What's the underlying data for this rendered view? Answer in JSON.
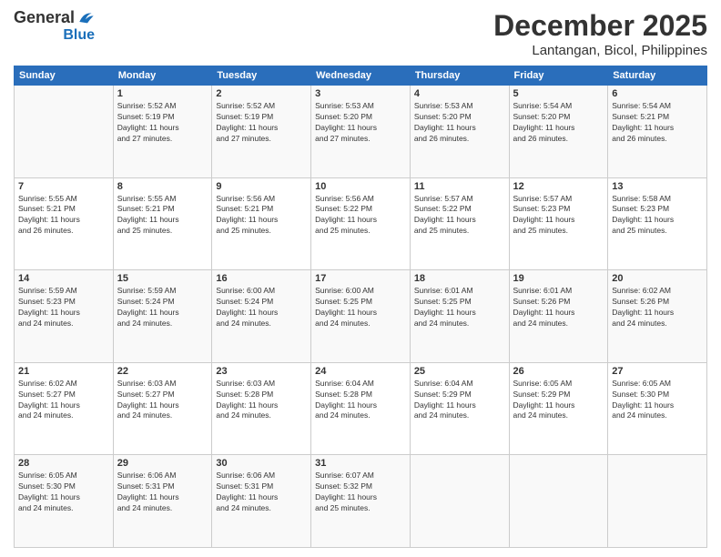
{
  "header": {
    "logo_line1": "General",
    "logo_line2": "Blue",
    "month": "December 2025",
    "location": "Lantangan, Bicol, Philippines"
  },
  "days_of_week": [
    "Sunday",
    "Monday",
    "Tuesday",
    "Wednesday",
    "Thursday",
    "Friday",
    "Saturday"
  ],
  "weeks": [
    [
      {
        "day": "",
        "info": ""
      },
      {
        "day": "1",
        "info": "Sunrise: 5:52 AM\nSunset: 5:19 PM\nDaylight: 11 hours\nand 27 minutes."
      },
      {
        "day": "2",
        "info": "Sunrise: 5:52 AM\nSunset: 5:19 PM\nDaylight: 11 hours\nand 27 minutes."
      },
      {
        "day": "3",
        "info": "Sunrise: 5:53 AM\nSunset: 5:20 PM\nDaylight: 11 hours\nand 27 minutes."
      },
      {
        "day": "4",
        "info": "Sunrise: 5:53 AM\nSunset: 5:20 PM\nDaylight: 11 hours\nand 26 minutes."
      },
      {
        "day": "5",
        "info": "Sunrise: 5:54 AM\nSunset: 5:20 PM\nDaylight: 11 hours\nand 26 minutes."
      },
      {
        "day": "6",
        "info": "Sunrise: 5:54 AM\nSunset: 5:21 PM\nDaylight: 11 hours\nand 26 minutes."
      }
    ],
    [
      {
        "day": "7",
        "info": "Sunrise: 5:55 AM\nSunset: 5:21 PM\nDaylight: 11 hours\nand 26 minutes."
      },
      {
        "day": "8",
        "info": "Sunrise: 5:55 AM\nSunset: 5:21 PM\nDaylight: 11 hours\nand 25 minutes."
      },
      {
        "day": "9",
        "info": "Sunrise: 5:56 AM\nSunset: 5:21 PM\nDaylight: 11 hours\nand 25 minutes."
      },
      {
        "day": "10",
        "info": "Sunrise: 5:56 AM\nSunset: 5:22 PM\nDaylight: 11 hours\nand 25 minutes."
      },
      {
        "day": "11",
        "info": "Sunrise: 5:57 AM\nSunset: 5:22 PM\nDaylight: 11 hours\nand 25 minutes."
      },
      {
        "day": "12",
        "info": "Sunrise: 5:57 AM\nSunset: 5:23 PM\nDaylight: 11 hours\nand 25 minutes."
      },
      {
        "day": "13",
        "info": "Sunrise: 5:58 AM\nSunset: 5:23 PM\nDaylight: 11 hours\nand 25 minutes."
      }
    ],
    [
      {
        "day": "14",
        "info": "Sunrise: 5:59 AM\nSunset: 5:23 PM\nDaylight: 11 hours\nand 24 minutes."
      },
      {
        "day": "15",
        "info": "Sunrise: 5:59 AM\nSunset: 5:24 PM\nDaylight: 11 hours\nand 24 minutes."
      },
      {
        "day": "16",
        "info": "Sunrise: 6:00 AM\nSunset: 5:24 PM\nDaylight: 11 hours\nand 24 minutes."
      },
      {
        "day": "17",
        "info": "Sunrise: 6:00 AM\nSunset: 5:25 PM\nDaylight: 11 hours\nand 24 minutes."
      },
      {
        "day": "18",
        "info": "Sunrise: 6:01 AM\nSunset: 5:25 PM\nDaylight: 11 hours\nand 24 minutes."
      },
      {
        "day": "19",
        "info": "Sunrise: 6:01 AM\nSunset: 5:26 PM\nDaylight: 11 hours\nand 24 minutes."
      },
      {
        "day": "20",
        "info": "Sunrise: 6:02 AM\nSunset: 5:26 PM\nDaylight: 11 hours\nand 24 minutes."
      }
    ],
    [
      {
        "day": "21",
        "info": "Sunrise: 6:02 AM\nSunset: 5:27 PM\nDaylight: 11 hours\nand 24 minutes."
      },
      {
        "day": "22",
        "info": "Sunrise: 6:03 AM\nSunset: 5:27 PM\nDaylight: 11 hours\nand 24 minutes."
      },
      {
        "day": "23",
        "info": "Sunrise: 6:03 AM\nSunset: 5:28 PM\nDaylight: 11 hours\nand 24 minutes."
      },
      {
        "day": "24",
        "info": "Sunrise: 6:04 AM\nSunset: 5:28 PM\nDaylight: 11 hours\nand 24 minutes."
      },
      {
        "day": "25",
        "info": "Sunrise: 6:04 AM\nSunset: 5:29 PM\nDaylight: 11 hours\nand 24 minutes."
      },
      {
        "day": "26",
        "info": "Sunrise: 6:05 AM\nSunset: 5:29 PM\nDaylight: 11 hours\nand 24 minutes."
      },
      {
        "day": "27",
        "info": "Sunrise: 6:05 AM\nSunset: 5:30 PM\nDaylight: 11 hours\nand 24 minutes."
      }
    ],
    [
      {
        "day": "28",
        "info": "Sunrise: 6:05 AM\nSunset: 5:30 PM\nDaylight: 11 hours\nand 24 minutes."
      },
      {
        "day": "29",
        "info": "Sunrise: 6:06 AM\nSunset: 5:31 PM\nDaylight: 11 hours\nand 24 minutes."
      },
      {
        "day": "30",
        "info": "Sunrise: 6:06 AM\nSunset: 5:31 PM\nDaylight: 11 hours\nand 24 minutes."
      },
      {
        "day": "31",
        "info": "Sunrise: 6:07 AM\nSunset: 5:32 PM\nDaylight: 11 hours\nand 25 minutes."
      },
      {
        "day": "",
        "info": ""
      },
      {
        "day": "",
        "info": ""
      },
      {
        "day": "",
        "info": ""
      }
    ]
  ]
}
